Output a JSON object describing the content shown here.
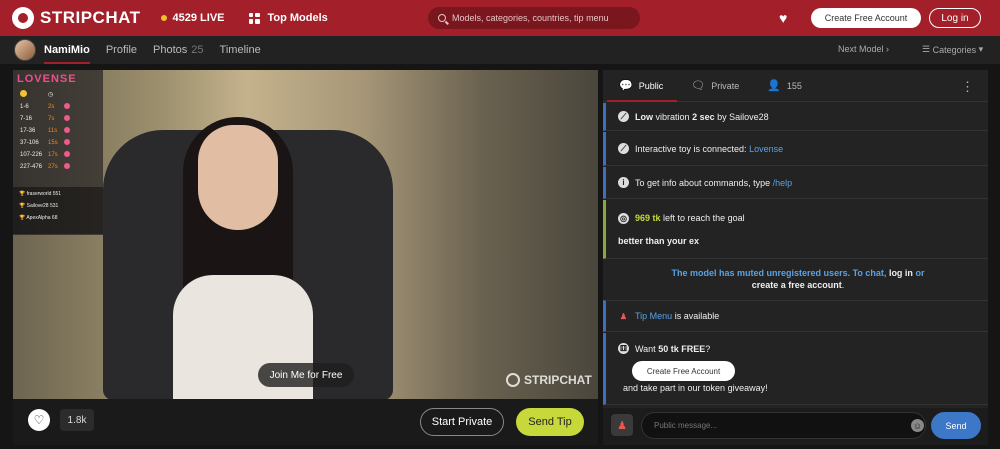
{
  "header": {
    "logo_text": "STRIPCHAT",
    "live_count": "4529 LIVE",
    "top_models": "Top Models",
    "search_placeholder": "Models, categories, countries, tip menu",
    "create_account": "Create Free Account",
    "login": "Log in"
  },
  "subnav": {
    "model_name": "NamiMio",
    "profile": "Profile",
    "photos": "Photos",
    "photos_count": "25",
    "timeline": "Timeline",
    "next_model": "Next Model",
    "categories": "Categories"
  },
  "video": {
    "lovense_title": "LOVENSE",
    "levels": [
      {
        "range": "1-6",
        "level": "2s"
      },
      {
        "range": "7-16",
        "level": "7s"
      },
      {
        "range": "17-36",
        "level": "11s"
      },
      {
        "range": "37-106",
        "level": "15s"
      },
      {
        "range": "107-226",
        "level": "17s"
      },
      {
        "range": "227-476",
        "level": "27s"
      }
    ],
    "leaders": [
      {
        "name": "fraserworld",
        "value": "551"
      },
      {
        "name": "Sailove28",
        "value": "531"
      },
      {
        "name": "ApexAlpha",
        "value": "68"
      }
    ],
    "join_label": "Join Me for Free",
    "watermark": "STRIPCHAT"
  },
  "controls": {
    "favorite_count": "1.8k",
    "start_private": "Start Private",
    "send_tip": "Send Tip"
  },
  "chat": {
    "tabs": {
      "public": "Public",
      "private": "Private",
      "users": "155"
    },
    "messages": {
      "vibe_prefix": "Low",
      "vibe_mid": "vibration",
      "vibe_time": "2 sec",
      "vibe_by": "by",
      "vibe_user": "Sailove28",
      "toy_text": "Interactive toy is connected:",
      "toy_brand": "Lovense",
      "help_text": "To get info about commands, type",
      "help_cmd": "/help",
      "goal_tokens": "969 tk",
      "goal_text": "left to reach the goal",
      "goal_name": "better than your ex",
      "muted_text": "The model has muted unregistered users. To chat,",
      "muted_login": "log in",
      "muted_or": "or",
      "muted_create": "create a free account",
      "muted_end": ".",
      "tip_menu_link": "Tip Menu",
      "tip_menu_text": "is available",
      "want_text": "Want",
      "want_bold": "50 tk FREE",
      "want_q": "?",
      "want_button": "Create Free Account",
      "want_tail": "and take part in our token giveaway!"
    },
    "input_placeholder": "Public message...",
    "send_label": "Send"
  }
}
